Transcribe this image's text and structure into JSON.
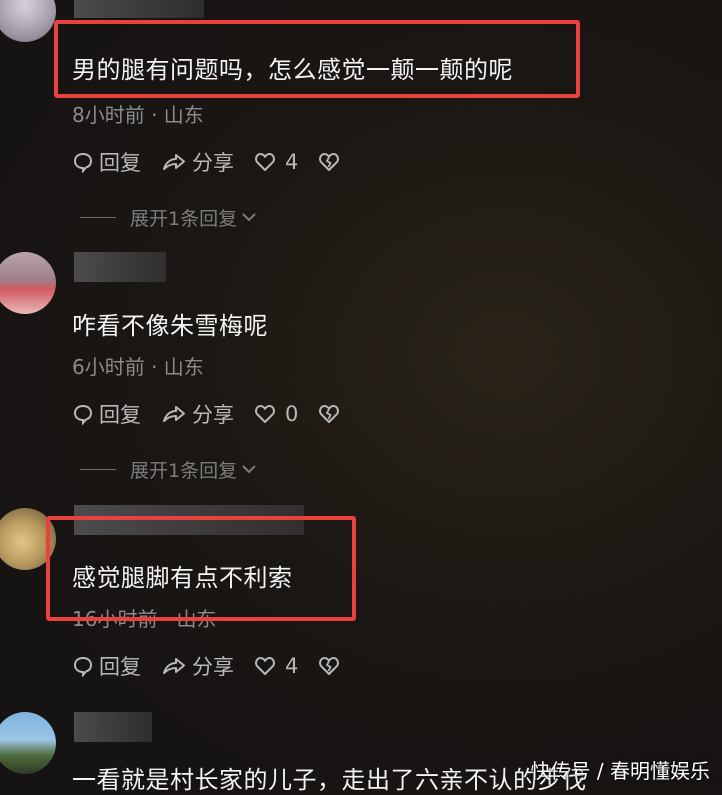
{
  "comments": [
    {
      "text": "男的腿有问题吗，怎么感觉一颠一颠的呢",
      "meta": "8小时前 · 山东",
      "reply_label": "回复",
      "share_label": "分享",
      "likes": "4",
      "expand_label": "展开1条回复"
    },
    {
      "text": "咋看不像朱雪梅呢",
      "meta": "6小时前 · 山东",
      "reply_label": "回复",
      "share_label": "分享",
      "likes": "0",
      "expand_label": "展开1条回复"
    },
    {
      "text": "感觉腿脚有点不利索",
      "meta": "16小时前 · 山东",
      "reply_label": "回复",
      "share_label": "分享",
      "likes": "4"
    },
    {
      "text": "一看就是村长家的儿子，走出了六亲不认的步伐"
    }
  ],
  "watermark": "快传号 / 春明懂娱乐",
  "colors": {
    "highlight_box": "#e8413e",
    "background": "#161314",
    "meta_text": "#8b8b8b"
  }
}
